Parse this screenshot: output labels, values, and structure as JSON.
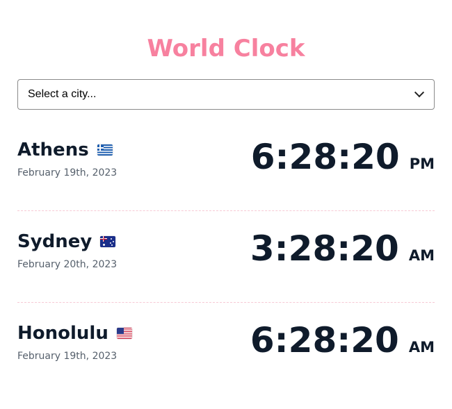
{
  "app": {
    "title": "World Clock"
  },
  "select": {
    "selected_label": "Select a city..."
  },
  "cities": [
    {
      "name": "Athens",
      "flag": "greece-flag",
      "date": "February 19th, 2023",
      "time": "6:28:20",
      "ampm": "PM"
    },
    {
      "name": "Sydney",
      "flag": "australia-flag",
      "date": "February 20th, 2023",
      "time": "3:28:20",
      "ampm": "AM"
    },
    {
      "name": "Honolulu",
      "flag": "united-states-flag",
      "date": "February 19th, 2023",
      "time": "6:28:20",
      "ampm": "AM"
    }
  ],
  "colors": {
    "title": "#f7819f",
    "text": "#0f1b2b",
    "date": "#56606c",
    "divider": "#f6c9d4"
  }
}
